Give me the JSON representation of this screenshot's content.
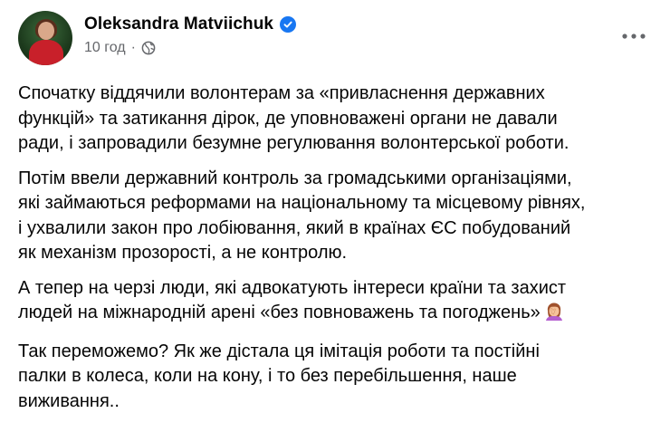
{
  "post": {
    "author": "Oleksandra Matviichuk",
    "time": "10 год",
    "separator": "·",
    "icons": {
      "verified": "verified-badge-icon",
      "privacy": "globe-icon",
      "menu": "more-options-icon",
      "emoji": "woman-facepalming-emoji"
    },
    "paragraphs": [
      {
        "lines": [
          "Спочатку віддячили волонтерам за «привласнення державних",
          "функцій» та затикання дірок, де уповноважені органи не давали",
          "ради, і запровадили безумне регулювання волонтерської роботи."
        ]
      },
      {
        "lines": [
          "Потім ввели державний контроль за громадськими організаціями,",
          "які займаються реформами на національному та місцевому рівнях,",
          "і ухвалили закон про лобіювання, який в країнах ЄС побудований",
          "як механізм прозорості, а не контролю."
        ]
      },
      {
        "lines": [
          "А тепер на черзі люди, які адвокатують інтереси країни та захист",
          "людей на міжнародній арені «без повноважень та погоджень»"
        ]
      },
      {
        "lines": [
          "Так переможемо? Як же дістала ця імітація роботи та постійні",
          "палки в колеса, коли на кону, і то без перебільшення, наше",
          "виживання.."
        ]
      }
    ]
  },
  "colors": {
    "text": "#050505",
    "secondary": "#65676b",
    "verified": "#1877f2"
  }
}
